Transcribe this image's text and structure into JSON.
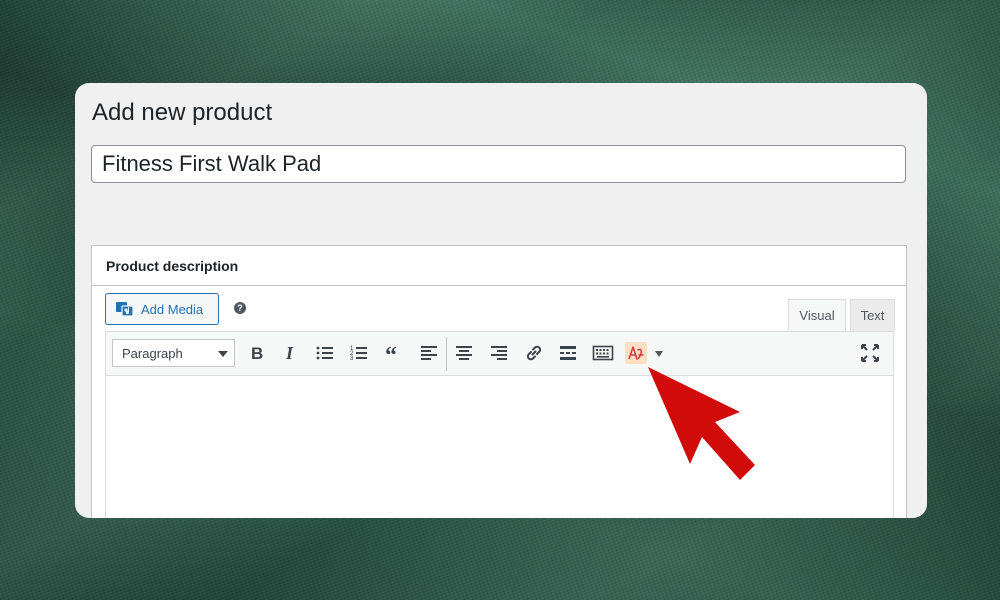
{
  "page": {
    "title": "Add new product"
  },
  "product": {
    "title_value": "Fitness First Walk Pad"
  },
  "description_box": {
    "heading": "Product description",
    "add_media_label": "Add Media",
    "help_glyph": "?",
    "tabs": [
      {
        "label": "Visual",
        "active": true
      },
      {
        "label": "Text",
        "active": false
      }
    ],
    "format_select": {
      "selected": "Paragraph"
    },
    "toolbar_icons": [
      "bold-icon",
      "italic-icon",
      "bulleted-list-icon",
      "numbered-list-icon",
      "blockquote-icon",
      "align-left-icon",
      "align-center-icon",
      "align-right-icon",
      "link-icon",
      "read-more-icon",
      "toolbar-toggle-icon",
      "text-style-plugin-icon",
      "dropdown-caret-icon",
      "fullscreen-icon"
    ]
  },
  "colors": {
    "accent": "#2271b1",
    "highlight": "#fde0c4",
    "plugin_icon": "#d63638",
    "annotation_arrow": "#d10a0a"
  },
  "annotation": {
    "icon": "red-arrow-pointer",
    "target": "text-style-plugin-icon"
  }
}
